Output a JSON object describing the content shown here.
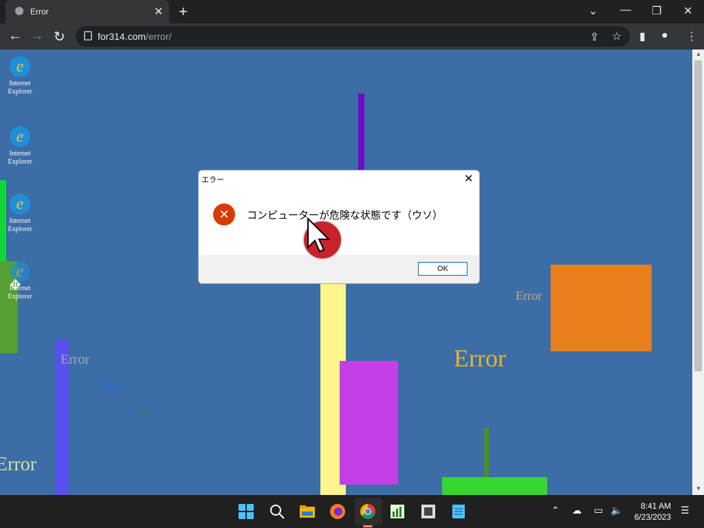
{
  "browser": {
    "tab_title": "Error",
    "url_host": "for314.com",
    "url_path": "/error/"
  },
  "desktop_icons": [
    {
      "label": "Internet Explorer"
    },
    {
      "label": "Internet Explorer"
    },
    {
      "label": "Internet Explorer"
    },
    {
      "label": "Internet Explorer"
    }
  ],
  "error_texts": [
    "Error",
    "Error",
    "Error",
    "Error",
    "Error",
    "Error"
  ],
  "dialog": {
    "title": "エラー",
    "message": "コンピューターが危険な状態です（ウソ）",
    "ok_label": "OK"
  },
  "taskbar": {
    "time": "8:41 AM",
    "date": "6/23/2023"
  },
  "colors": {
    "page_background": "#3c6da6",
    "browser_frame": "#202124"
  }
}
